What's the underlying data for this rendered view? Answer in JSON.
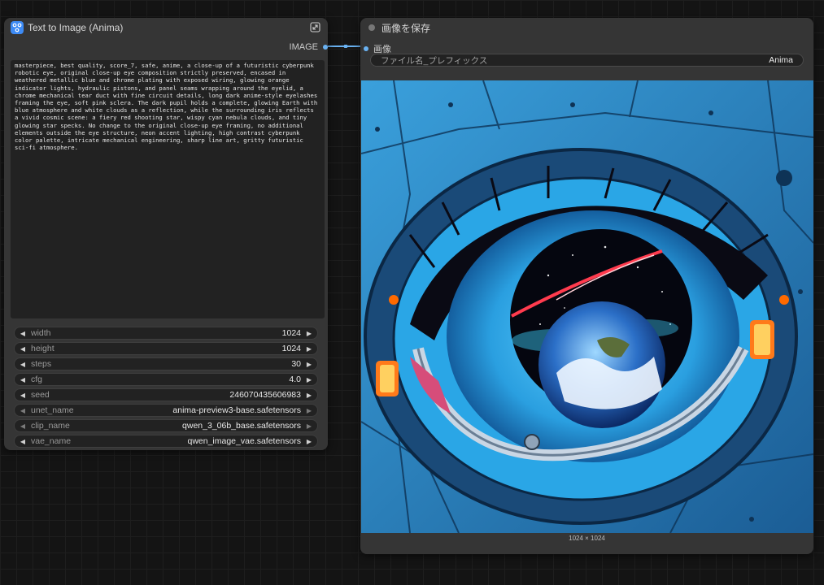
{
  "left_node": {
    "title": "Text to Image (Anima)",
    "output_label": "IMAGE",
    "prompt": "masterpiece, best quality, score_7, safe, anime, a close-up of a futuristic cyberpunk\nrobotic eye, original close-up eye composition strictly preserved, encased in\nweathered metallic blue and chrome plating with exposed wiring, glowing orange\nindicator lights, hydraulic pistons, and panel seams wrapping around the eyelid, a\nchrome mechanical tear duct with fine circuit details, long dark anime-style eyelashes\nframing the eye, soft pink sclera. The dark pupil holds a complete, glowing Earth with\nblue atmosphere and white clouds as a reflection, while the surrounding iris reflects\na vivid cosmic scene: a fiery red shooting star, wispy cyan nebula clouds, and tiny\nglowing star specks. No change to the original close-up eye framing, no additional\nelements outside the eye structure, neon accent lighting, high contrast cyberpunk\ncolor palette, intricate mechanical engineering, sharp line art, gritty futuristic\nsci-fi atmosphere.",
    "widgets": [
      {
        "name": "width",
        "value": "1024",
        "kind": "number"
      },
      {
        "name": "height",
        "value": "1024",
        "kind": "number"
      },
      {
        "name": "steps",
        "value": "30",
        "kind": "number"
      },
      {
        "name": "cfg",
        "value": "4.0",
        "kind": "number"
      },
      {
        "name": "seed",
        "value": "246070435606983",
        "kind": "number"
      },
      {
        "name": "unet_name",
        "value": "anima-preview3-base.safetensors",
        "kind": "combo"
      },
      {
        "name": "clip_name",
        "value": "qwen_3_06b_base.safetensors",
        "kind": "combo"
      },
      {
        "name": "vae_name",
        "value": "qwen_image_vae.safetensors",
        "kind": "number"
      }
    ]
  },
  "right_node": {
    "title": "画像を保存",
    "input_label": "画像",
    "filename_prefix_label": "ファイル名_プレフィックス",
    "filename_prefix_value": "Anima",
    "image_size": "1024 × 1024"
  },
  "colors": {
    "accent": "#3d8bf5",
    "link": "#6ab2f2",
    "node_bg": "#353535",
    "canvas_bg": "#141414"
  }
}
